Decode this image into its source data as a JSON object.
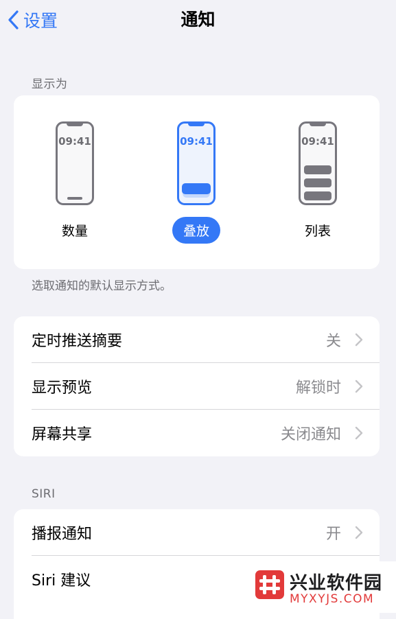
{
  "nav": {
    "back_label": "设置",
    "title": "通知"
  },
  "display_as": {
    "header": "显示为",
    "footer": "选取通知的默认显示方式。",
    "options": [
      {
        "label": "数量",
        "time": "09:41",
        "selected": false
      },
      {
        "label": "叠放",
        "time": "09:41",
        "selected": true
      },
      {
        "label": "列表",
        "time": "09:41",
        "selected": false
      }
    ]
  },
  "settings": {
    "rows": [
      {
        "label": "定时推送摘要",
        "value": "关"
      },
      {
        "label": "显示预览",
        "value": "解锁时"
      },
      {
        "label": "屏幕共享",
        "value": "关闭通知"
      }
    ]
  },
  "siri": {
    "header": "SIRI",
    "rows": [
      {
        "label": "播报通知",
        "value": "开"
      },
      {
        "label": "Siri 建议",
        "value": ""
      }
    ]
  },
  "watermark": {
    "name": "兴业软件园",
    "url": "MYXYJS.COM"
  },
  "colors": {
    "accent": "#3478F6",
    "background": "#F2F2F7",
    "secondary_text": "#8A8A8E",
    "watermark_red": "#E23A3A"
  },
  "icons": {
    "back": "chevron-left-icon",
    "row_disclosure": "chevron-right-icon",
    "watermark_logo": "hash-logo-icon"
  }
}
